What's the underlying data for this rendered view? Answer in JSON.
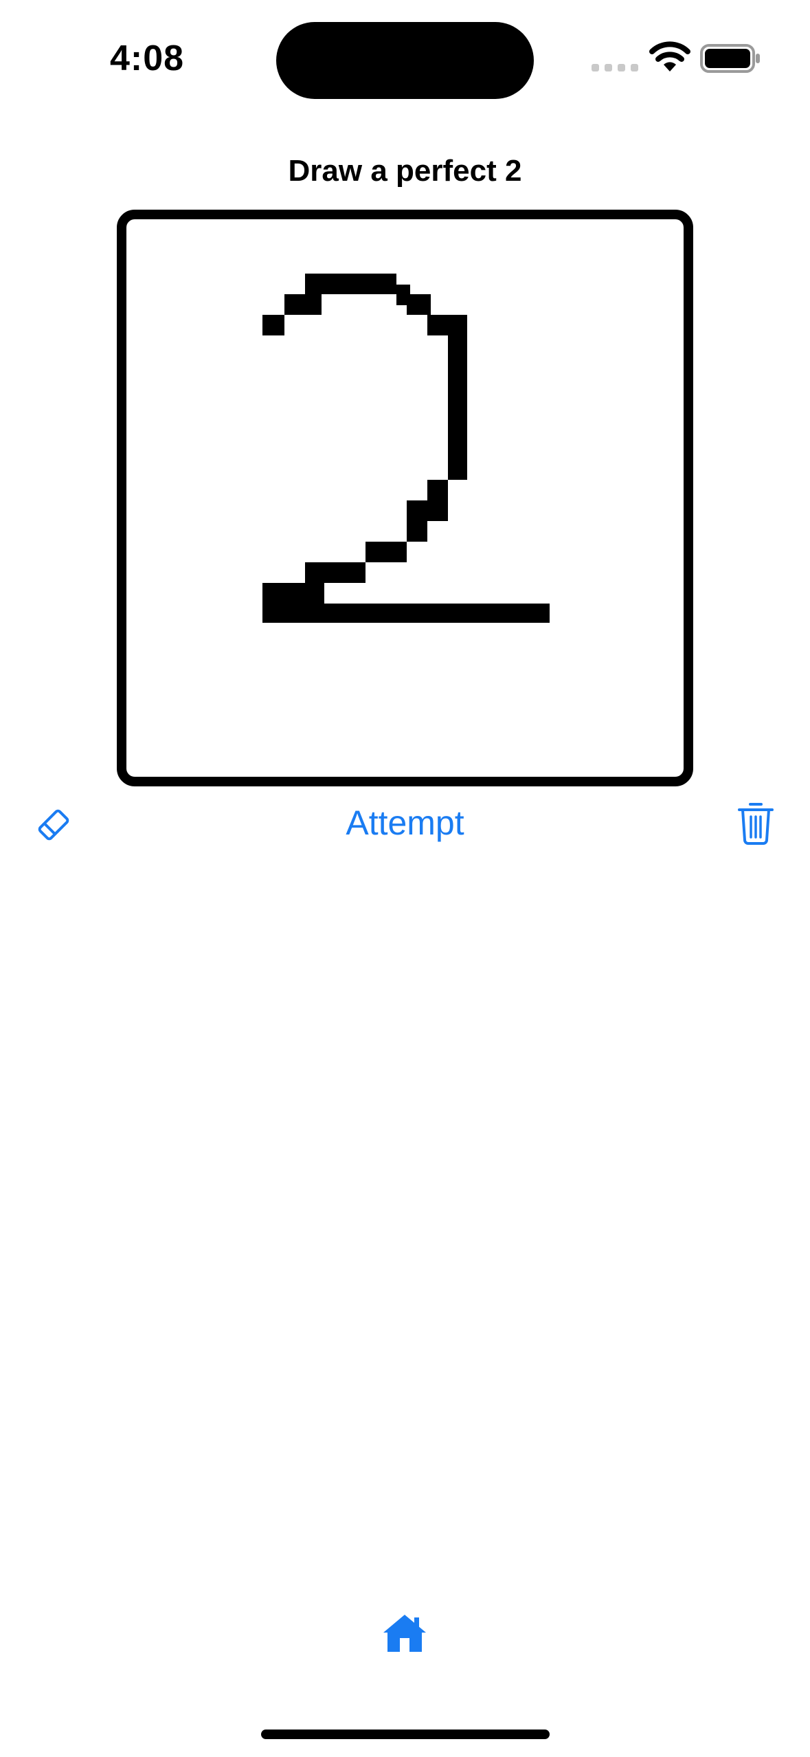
{
  "status_bar": {
    "time": "4:08",
    "icons": [
      "signal-dots-icon",
      "wifi-icon",
      "battery-icon"
    ]
  },
  "screen": {
    "title": "Draw a perfect 2"
  },
  "drawing_canvas": {
    "drawn_digit": "2",
    "pixel_grid_size": 28
  },
  "toolbar": {
    "eraser_icon": "eraser-icon",
    "attempt_label": "Attempt",
    "trash_icon": "trash-icon"
  },
  "bottom": {
    "home_icon": "house-icon"
  },
  "colors": {
    "accent": "#1a7cf2",
    "ink": "#000000",
    "background": "#ffffff"
  }
}
